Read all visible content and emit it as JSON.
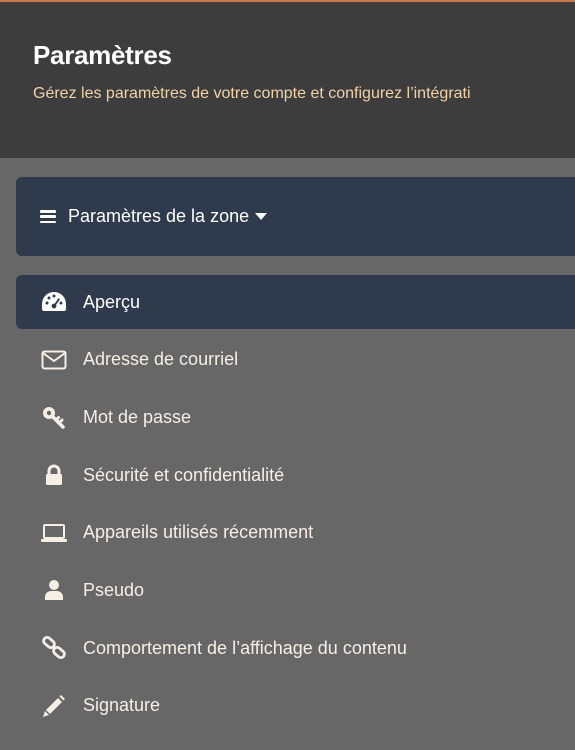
{
  "header": {
    "title": "Paramètres",
    "subtitle": "Gérez les paramètres de votre compte et configurez l’intégrati"
  },
  "zone": {
    "label": "Paramètres de la zone"
  },
  "menu": {
    "items": [
      {
        "label": "Aperçu",
        "icon": "dashboard-icon",
        "active": true
      },
      {
        "label": "Adresse de courriel",
        "icon": "envelope-icon"
      },
      {
        "label": "Mot de passe",
        "icon": "key-icon"
      },
      {
        "label": "Sécurité et confidentialité",
        "icon": "lock-icon"
      },
      {
        "label": "Appareils utilisés récemment",
        "icon": "laptop-icon"
      },
      {
        "label": "Pseudo",
        "icon": "user-icon"
      },
      {
        "label": "Comportement de l’affichage du contenu",
        "icon": "link-icon"
      },
      {
        "label": "Signature",
        "icon": "pencil-icon"
      }
    ]
  },
  "colors": {
    "accent": "#c7794d",
    "header_bg": "#3d3d3d",
    "active_bg": "#2f3a4c",
    "page_bg": "#676767",
    "subtitle": "#f2d2a8"
  }
}
